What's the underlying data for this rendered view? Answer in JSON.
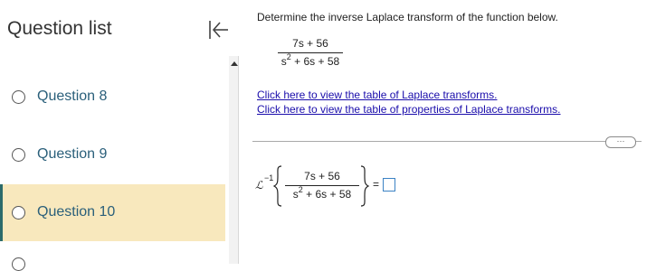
{
  "sidebar": {
    "title": "Question list",
    "questions": [
      {
        "label": "Question 8"
      },
      {
        "label": "Question 9"
      },
      {
        "label": "Question 10",
        "active": true
      }
    ]
  },
  "problem": {
    "prompt": "Determine the inverse Laplace transform of the function below.",
    "numerator": "7s + 56",
    "denominator_base": "s",
    "denominator_exp": "2",
    "denominator_rest": " + 6s + 58",
    "links": [
      "Click here to view the table of Laplace transforms.",
      "Click here to view the table of properties of Laplace transforms."
    ],
    "more_label": "···",
    "operator_symbol": "ℒ",
    "inverse_exp": "−1",
    "equals": "="
  },
  "colors": {
    "active_bg": "#f8e8bd",
    "link": "#1a0dab",
    "question_label": "#2a5f7a"
  }
}
